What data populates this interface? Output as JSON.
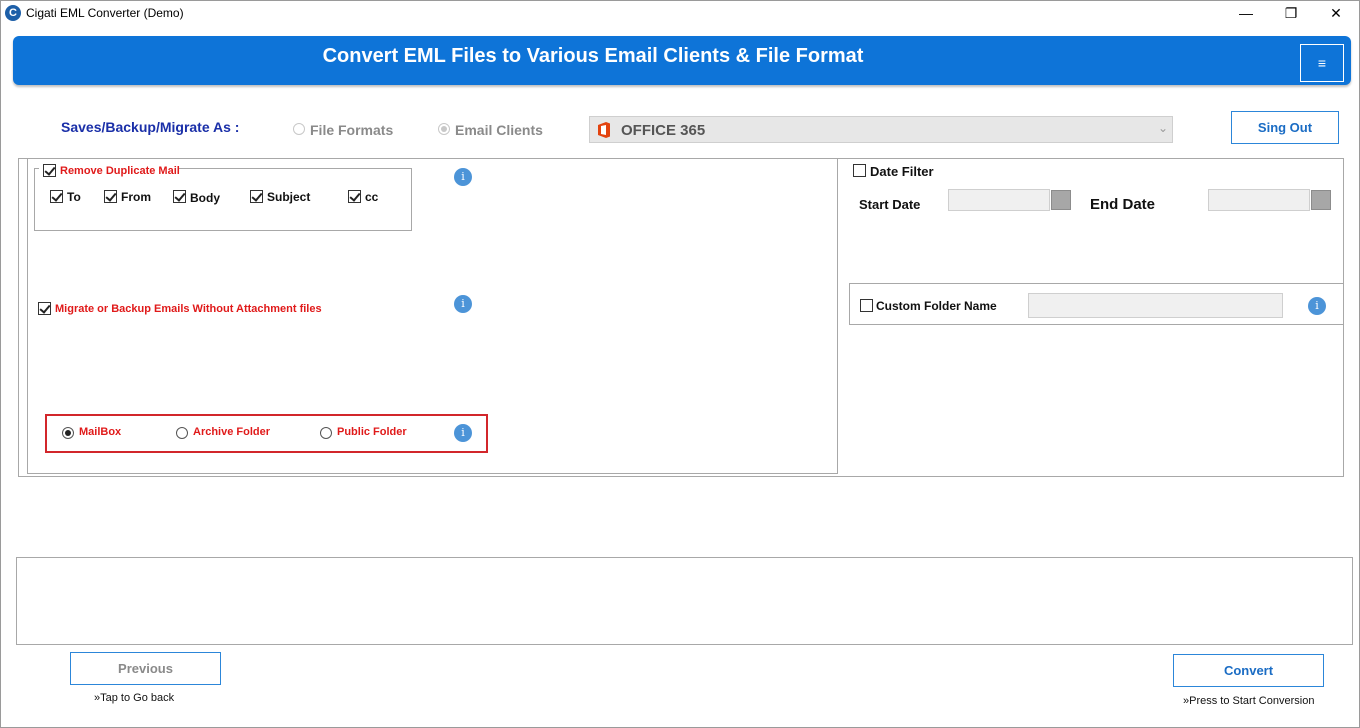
{
  "window": {
    "title": "Cigati EML Converter (Demo)",
    "icon_glyph": "C",
    "minimize": "—",
    "maximize": "❐",
    "close": "✕"
  },
  "banner": {
    "title": "Convert EML Files to Various Email Clients & File Format",
    "menu_glyph": "≡"
  },
  "save_as": {
    "label": "Saves/Backup/Migrate As :",
    "options": [
      {
        "label": "File Formats",
        "selected": false
      },
      {
        "label": "Email Clients",
        "selected": true
      }
    ],
    "selected_client": "OFFICE 365",
    "dropdown_arrow": "⌄"
  },
  "signout_label": "Sing Out",
  "duplicate": {
    "label": "Remove Duplicate Mail",
    "checked": true,
    "fields": [
      {
        "label": "To",
        "checked": true
      },
      {
        "label": "From",
        "checked": true
      },
      {
        "label": "Body",
        "checked": true
      },
      {
        "label": "Subject",
        "checked": true
      },
      {
        "label": "cc",
        "checked": true
      }
    ]
  },
  "no_attachment": {
    "label": "Migrate or Backup Emails Without Attachment files",
    "checked": true
  },
  "mailbox_type": {
    "options": [
      {
        "label": "MailBox",
        "selected": true
      },
      {
        "label": "Archive Folder",
        "selected": false
      },
      {
        "label": "Public Folder",
        "selected": false
      }
    ]
  },
  "info_glyph": "i",
  "date_filter": {
    "label": "Date Filter",
    "checked": false,
    "start_label": "Start Date",
    "end_label": "End Date"
  },
  "custom_folder": {
    "label": "Custom Folder Name",
    "checked": false
  },
  "footer": {
    "previous_label": "Previous",
    "previous_hint": "»Tap to Go back",
    "convert_label": "Convert",
    "convert_hint": "»Press to Start Conversion"
  },
  "colors": {
    "banner": "#0e74d8",
    "accent": "#2c86d9",
    "warning_red": "#e01a1a",
    "label_blue": "#1a2fa8"
  }
}
